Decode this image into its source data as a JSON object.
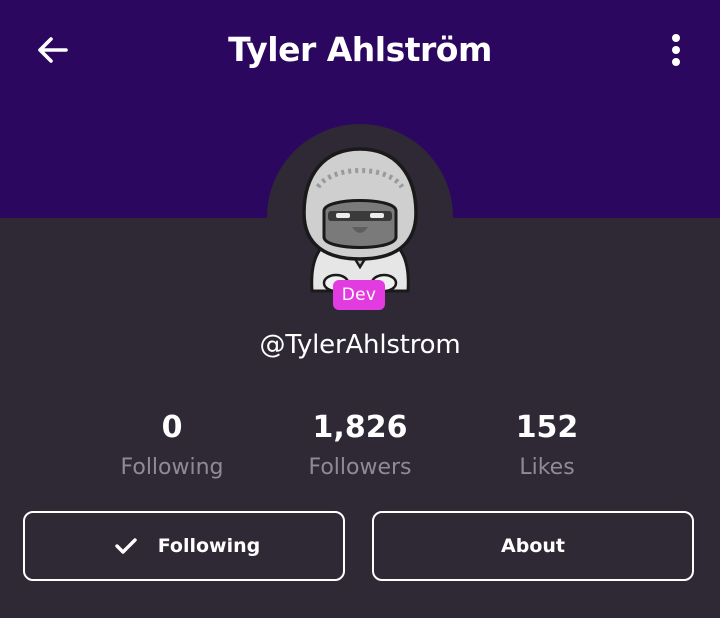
{
  "header": {
    "title": "Tyler Ahlström",
    "back_icon": "arrow-left-icon",
    "menu_icon": "more-vertical-icon"
  },
  "profile": {
    "avatar": "hooded-character-avatar",
    "badge": "Dev",
    "username": "@TylerAhlstrom"
  },
  "stats": [
    {
      "value": "0",
      "label": "Following"
    },
    {
      "value": "1,826",
      "label": "Followers"
    },
    {
      "value": "152",
      "label": "Likes"
    }
  ],
  "actions": {
    "following_label": "Following",
    "following_icon": "checkmark-icon",
    "about_label": "About"
  },
  "colors": {
    "header_bg": "#2b0760",
    "body_bg": "#2e2935",
    "badge_bg": "#e23be0",
    "muted_text": "#8f8b96"
  }
}
